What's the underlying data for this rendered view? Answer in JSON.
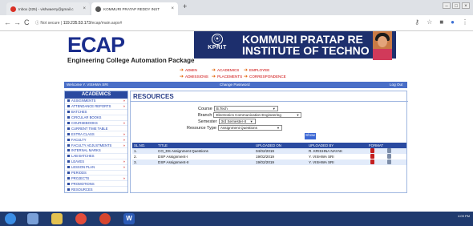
{
  "browser": {
    "tabs": [
      {
        "label": "Inbox (325) - vishwaerry@gmail.c",
        "active": false
      },
      {
        "label": "KOMMURI PRATAP REDDY INST",
        "active": true
      }
    ],
    "address": {
      "secure_label": "Not secure",
      "host": "119.235.53.173",
      "path": "/ecap/main.aspx#"
    }
  },
  "banner": {
    "logo": "ECAP",
    "subtitle": "Engineering College Automation Package",
    "kprit_label": "KPRIT",
    "institute_line1": "KOMMURI PRATAP RE",
    "institute_line2": "INSTITUTE OF TECHNO"
  },
  "topmenu": {
    "items": [
      "ADMIN",
      "ACADEMICS",
      "EMPLOYEE",
      "ADMISSIONS",
      "PLACEMENTS",
      "CORRESPONDENCE"
    ]
  },
  "bluebar": {
    "welcome": "Welcome Y. VISHWA SRI",
    "change_password": "Change Password",
    "logout": "Log Out"
  },
  "sidebar": {
    "heading": "ACADEMICS",
    "items": [
      {
        "label": "ASSIGNMENTS",
        "more": "»"
      },
      {
        "label": "ATTENDANCE REPORTS",
        "more": "»"
      },
      {
        "label": "BATCHES",
        "more": ""
      },
      {
        "label": "CIRCULAR BOOKS",
        "more": ""
      },
      {
        "label": "COURSEBOOKS",
        "more": "»"
      },
      {
        "label": "CURRENT TIME TABLE",
        "more": ""
      },
      {
        "label": "EXTRA CLASS",
        "more": "»"
      },
      {
        "label": "FACULTY",
        "more": "»"
      },
      {
        "label": "FACULTY ADJUSTMENTS",
        "more": "»"
      },
      {
        "label": "INTERNAL MARKS",
        "more": ""
      },
      {
        "label": "LAB BATCHES",
        "more": ""
      },
      {
        "label": "LEAVES",
        "more": "»"
      },
      {
        "label": "LESSON PLAN",
        "more": "»"
      },
      {
        "label": "PERIODS",
        "more": ""
      },
      {
        "label": "PROJECTS",
        "more": "»"
      },
      {
        "label": "PROMOTIONS",
        "more": ""
      },
      {
        "label": "RESOURCES",
        "more": ""
      }
    ]
  },
  "resources": {
    "title": "RESOURCES",
    "course_label": "Course",
    "course_value": "B.Tech",
    "branch_label": "Branch",
    "branch_value": "Electronics Communication Engineering",
    "semester_label": "Semester",
    "semester_value": "3rd Semester-II",
    "type_label": "Resource Type",
    "type_value": "Assignment Questions",
    "show_button": "Show",
    "columns": [
      "SL.NO.",
      "TITLE",
      "UPLOADED ON",
      "UPLOADED BY",
      "FORMAT"
    ],
    "rows": [
      {
        "sl": "1.",
        "title": "CO_DS Assignment Questions",
        "uploaded_on": "04/02/2019",
        "uploaded_by": "R. KRISHNA NAYAK"
      },
      {
        "sl": "2.",
        "title": "DSP Assignment-I",
        "uploaded_on": "19/02/2019",
        "uploaded_by": "Y. VISHWA SRI"
      },
      {
        "sl": "3.",
        "title": "DSP Assignment-II",
        "uploaded_on": "19/02/2019",
        "uploaded_by": "Y. VISHWA SRI"
      }
    ]
  },
  "taskbar": {
    "time": "4:09 PM"
  }
}
